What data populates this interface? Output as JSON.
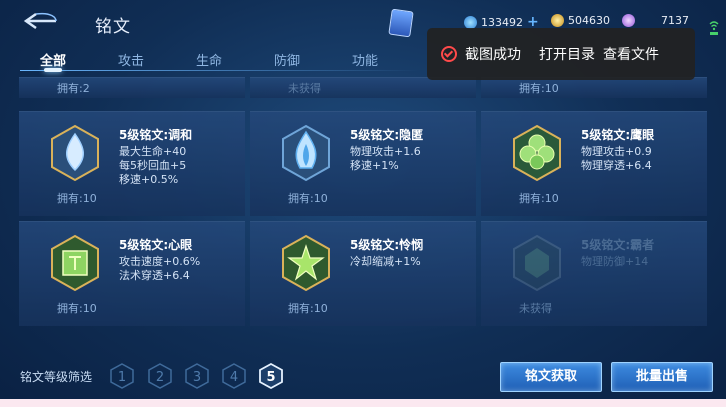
{
  "header": {
    "title": "铭文",
    "resources": [
      {
        "icon": "blue-gem-icon",
        "value": "133492"
      },
      {
        "icon": "gold-coin-icon",
        "value": "504630"
      },
      {
        "icon": "purple-crystal-icon",
        "value": "7137"
      }
    ]
  },
  "tabs": [
    {
      "label": "全部",
      "active": true
    },
    {
      "label": "攻击"
    },
    {
      "label": "生命"
    },
    {
      "label": "防御"
    },
    {
      "label": "功能"
    }
  ],
  "toast": {
    "message": "截图成功",
    "action_open": "打开目录",
    "action_view": "查看文件"
  },
  "top_row_owned": [
    "拥有:2",
    "未获得",
    "拥有:10"
  ],
  "cards": [
    {
      "name": "5级铭文:调和",
      "stats": [
        "最大生命+40",
        "每5秒回血+5",
        "移速+0.5%"
      ],
      "owned": "拥有:10",
      "gem": "teardrop-gem-icon"
    },
    {
      "name": "5级铭文:隐匿",
      "stats": [
        "物理攻击+1.6",
        "移速+1%"
      ],
      "owned": "拥有:10",
      "gem": "flame-gem-icon"
    },
    {
      "name": "5级铭文:鹰眼",
      "stats": [
        "物理攻击+0.9",
        "物理穿透+6.4"
      ],
      "owned": "拥有:10",
      "gem": "clover-gem-icon"
    },
    {
      "name": "5级铭文:心眼",
      "stats": [
        "攻击速度+0.6%",
        "法术穿透+6.4"
      ],
      "owned": "拥有:10",
      "gem": "square-gem-icon"
    },
    {
      "name": "5级铭文:怜悯",
      "stats": [
        "冷却缩减+1%"
      ],
      "owned": "拥有:10",
      "gem": "star-gem-icon"
    },
    {
      "name": "5级铭文:霸者",
      "stats": [
        "物理防御+14"
      ],
      "owned": "未获得",
      "gem": "hex-gem-icon",
      "locked": true
    }
  ],
  "filter": {
    "label": "铭文等级筛选",
    "levels": [
      "1",
      "2",
      "3",
      "4",
      "5"
    ],
    "selected": "5"
  },
  "buttons": {
    "obtain": "铭文获取",
    "sell": "批量出售"
  },
  "colors": {
    "accent": "#3d8be0",
    "background": "#0d2a4d",
    "tab_active": "#ffffff"
  }
}
